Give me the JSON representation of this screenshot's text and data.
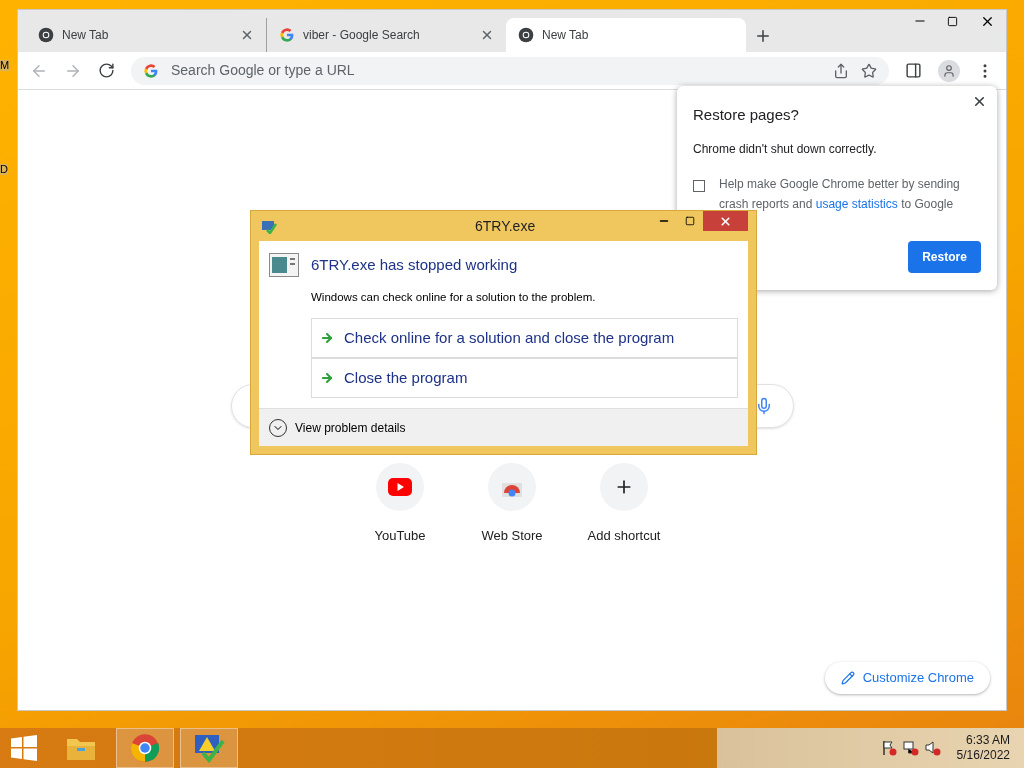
{
  "desktop": {
    "icon_labels": [
      "M",
      "D"
    ]
  },
  "browser": {
    "tabs": [
      {
        "title": "New Tab",
        "kind": "chrome",
        "selected": false
      },
      {
        "title": "viber - Google Search",
        "kind": "google",
        "selected": false
      },
      {
        "title": "New Tab",
        "kind": "chrome",
        "selected": true
      }
    ],
    "address_bar": {
      "placeholder": "Search Google or type a URL"
    },
    "shortcuts": [
      {
        "label": "YouTube",
        "kind": "youtube"
      },
      {
        "label": "Web Store",
        "kind": "webstore"
      },
      {
        "label": "Add shortcut",
        "kind": "add"
      }
    ],
    "customize_button": "Customize Chrome"
  },
  "restore_popup": {
    "title": "Restore pages?",
    "message": "Chrome didn't shut down correctly.",
    "consent": {
      "text_before": "Help make Google Chrome better by sending crash reports and",
      "link": "usage statistics",
      "text_after": "to Google",
      "checked": false
    },
    "button": "Restore"
  },
  "error_dialog": {
    "title": "6TRY.exe",
    "heading": "6TRY.exe has stopped working",
    "message": "Windows can check online for a solution to the problem.",
    "options": [
      "Check online for a solution and close the program",
      "Close the program"
    ],
    "details": "View problem details"
  },
  "taskbar": {
    "apps": [
      {
        "kind": "explorer",
        "running": false
      },
      {
        "kind": "chrome",
        "running": true
      },
      {
        "kind": "error-reporter",
        "running": true
      }
    ],
    "time": "6:33 AM",
    "date": "5/16/2022"
  }
}
